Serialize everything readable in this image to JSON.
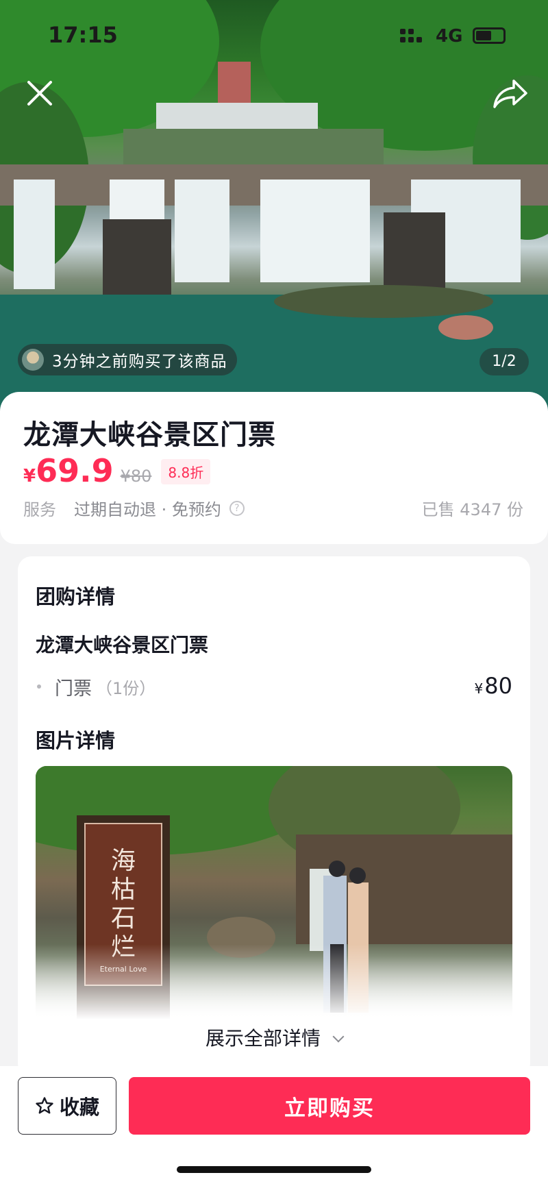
{
  "status_bar": {
    "time": "17:15",
    "network": "4G"
  },
  "hero": {
    "buyer_notice": "3分钟之前购买了该商品",
    "page_indicator": "1/2"
  },
  "product": {
    "title": "龙潭大峡谷景区门票",
    "price_symbol": "¥",
    "price": "69.9",
    "original_price": "¥80",
    "discount": "8.8折",
    "service_label": "服务",
    "service_text": "过期自动退 · 免预约",
    "sold": "已售 4347 份"
  },
  "details": {
    "group_title": "团购详情",
    "deal_name": "龙潭大峡谷景区门票",
    "items": [
      {
        "name": "门票",
        "qty": "（1份）",
        "price_symbol": "¥",
        "price": "80"
      }
    ],
    "image_title": "图片详情",
    "sign_text": "海枯石烂",
    "sign_subtext": "Eternal Love",
    "show_all": "展示全部详情"
  },
  "bottom_bar": {
    "favorite": "收藏",
    "buy_now": "立即购买"
  },
  "colors": {
    "accent": "#fe2c55",
    "text": "#161823",
    "muted": "#a8a8ad"
  }
}
